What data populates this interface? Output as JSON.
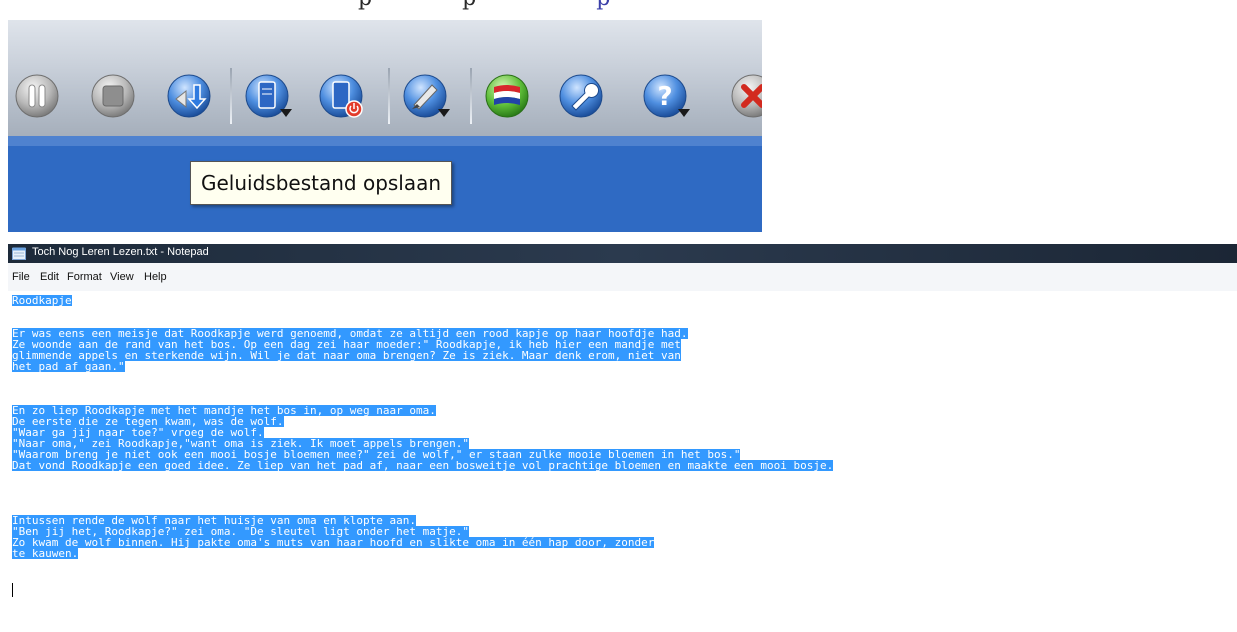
{
  "top_snippet": {
    "cut_text_left": "p",
    "cut_text_mid": "p",
    "cut_text_right": "p"
  },
  "toolbar": {
    "buttons": [
      {
        "icon": "pause-icon"
      },
      {
        "icon": "stop-icon"
      },
      {
        "icon": "save-audio-icon"
      },
      {
        "icon": "document-down-icon"
      },
      {
        "icon": "document-power-icon"
      },
      {
        "icon": "brush-down-icon"
      },
      {
        "icon": "dutch-flag-icon"
      },
      {
        "icon": "wrench-icon"
      },
      {
        "icon": "help-down-icon"
      },
      {
        "icon": "close-icon"
      }
    ],
    "tooltip": "Geluidsbestand opslaan"
  },
  "notepad": {
    "title": "Toch Nog Leren Lezen.txt - Notepad",
    "menu": [
      "File",
      "Edit",
      "Format",
      "View",
      "Help"
    ],
    "lines": [
      "Roodkapje",
      "Er was eens een meisje dat Roodkapje werd genoemd, omdat ze altijd een rood kapje op haar hoofdje had.",
      "Ze woonde aan de rand van het bos. Op een dag zei haar moeder:\" Roodkapje, ik heb hier een mandje met",
      "glimmende appels en sterkende wijn. Wil je dat naar oma brengen? Ze is ziek. Maar denk erom, niet van",
      "het pad af gaan.\"",
      "En zo liep Roodkapje met het mandje het bos in, op weg naar oma.",
      "De eerste die ze tegen kwam, was de wolf.",
      "\"Waar ga jij naar toe?\" vroeg de wolf.",
      "\"Naar oma,\" zei Roodkapje,\"want oma is ziek. Ik moet appels brengen.\"",
      "\"Waarom breng je niet ook een mooi bosje bloemen mee?\" zei de wolf,\" er staan zulke mooie bloemen in het bos.\"",
      "Dat vond Roodkapje een goed idee. Ze liep van het pad af, naar een bosweitje vol prachtige bloemen en maakte een mooi bosje.",
      "Intussen rende de wolf naar het huisje van oma en klopte aan.",
      "\"Ben jij het, Roodkapje?\" zei oma. \"De sleutel ligt onder het matje.\"",
      "Zo kwam de wolf binnen. Hij pakte oma's muts van haar hoofd en slikte oma in één hap door, zonder",
      "te kauwen."
    ]
  }
}
